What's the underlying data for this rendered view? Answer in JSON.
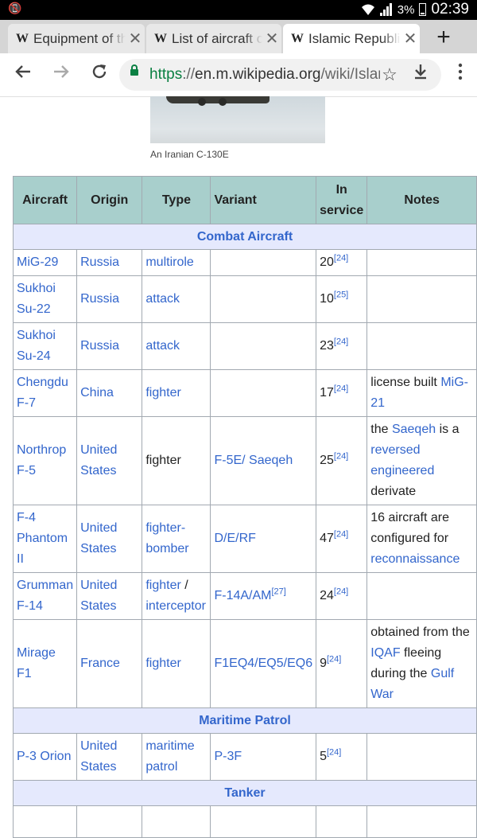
{
  "status": {
    "battery": "3%",
    "time": "02:39"
  },
  "tabs": [
    {
      "title": "Equipment of the Islamic Republic",
      "active": false
    },
    {
      "title": "List of aircraft of the Iranian",
      "active": false
    },
    {
      "title": "Islamic Republic of Iran Air Force",
      "active": true
    }
  ],
  "url": {
    "scheme": "https",
    "sep": "://",
    "host": "en.m.wikipedia.org",
    "path": "/wiki/Islamic_Republic_of_Iran_Air_Force"
  },
  "figure": {
    "caption": "An Iranian C-130E"
  },
  "table": {
    "headers": {
      "aircraft": "Aircraft",
      "origin": "Origin",
      "type": "Type",
      "variant": "Variant",
      "in_service_1": "In",
      "in_service_2": "service",
      "notes": "Notes"
    },
    "sections": {
      "combat": "Combat Aircraft",
      "maritime": "Maritime Patrol",
      "tanker": "Tanker"
    },
    "rows": [
      {
        "aircraft": [
          "MiG-29"
        ],
        "origin": [
          "Russia"
        ],
        "type": [
          "multirole"
        ],
        "variant": "",
        "count": "20",
        "ref": "[24]"
      },
      {
        "aircraft": [
          "Sukhoi",
          "Su-22"
        ],
        "origin": [
          "Russia"
        ],
        "type": [
          "attack"
        ],
        "variant": "",
        "count": "10",
        "ref": "[25]"
      },
      {
        "aircraft": [
          "Sukhoi",
          "Su-24"
        ],
        "origin": [
          "Russia"
        ],
        "type": [
          "attack"
        ],
        "variant": "",
        "count": "23",
        "ref": "[24]"
      },
      {
        "aircraft": [
          "Chengdu",
          "F-7"
        ],
        "origin": [
          "China"
        ],
        "type": [
          "fighter"
        ],
        "variant": "",
        "count": "17",
        "ref": "[24]",
        "notes": {
          "l1_text": "license built ",
          "l1_link": "MiG-",
          "l2_link": "21"
        }
      },
      {
        "aircraft": [
          "Northrop",
          "F-5"
        ],
        "origin": [
          "United",
          "States"
        ],
        "type": [
          "fighter"
        ],
        "variant": "F-5E/ Saeqeh",
        "count": "25",
        "ref": "[24]",
        "notes": {
          "l1_a": "the ",
          "l1_link": "Saeqeh",
          "l1_b": " is a",
          "l2": "reversed",
          "l3": "engineered",
          "l4": "derivate"
        }
      },
      {
        "aircraft": [
          "F-4",
          "Phantom",
          "II"
        ],
        "origin": [
          "United",
          "States"
        ],
        "type": [
          "fighter-",
          "bomber"
        ],
        "variant": "D/E/RF",
        "count": "47",
        "ref": "[24]",
        "notes": {
          "l1": "16 aircraft are",
          "l2": "configured for",
          "l3": "reconnaissance"
        }
      },
      {
        "aircraft": [
          "Grumman",
          "F-14"
        ],
        "origin": [
          "United",
          "States"
        ],
        "type": [
          "fighter",
          "interceptor"
        ],
        "variant": "F-14A/AM",
        "variant_ref": "[27]",
        "count": "24",
        "ref": "[24]"
      },
      {
        "aircraft": [
          "Mirage",
          "F1"
        ],
        "origin": [
          "France"
        ],
        "type": [
          "fighter"
        ],
        "variant": "F1EQ4/EQ5/EQ6",
        "count": "9",
        "ref": "[24]",
        "notes": {
          "l1": "obtained from the",
          "l2_link": "IQAF",
          "l2_b": " fleeing",
          "l3_a": "during the ",
          "l3_link": "Gulf",
          "l4_link": "War"
        }
      },
      {
        "aircraft": [
          "P-3 Orion"
        ],
        "origin": [
          "United",
          "States"
        ],
        "type": [
          "maritime",
          "patrol"
        ],
        "variant": "P-3F",
        "count": "5",
        "ref": "[24]"
      }
    ]
  }
}
